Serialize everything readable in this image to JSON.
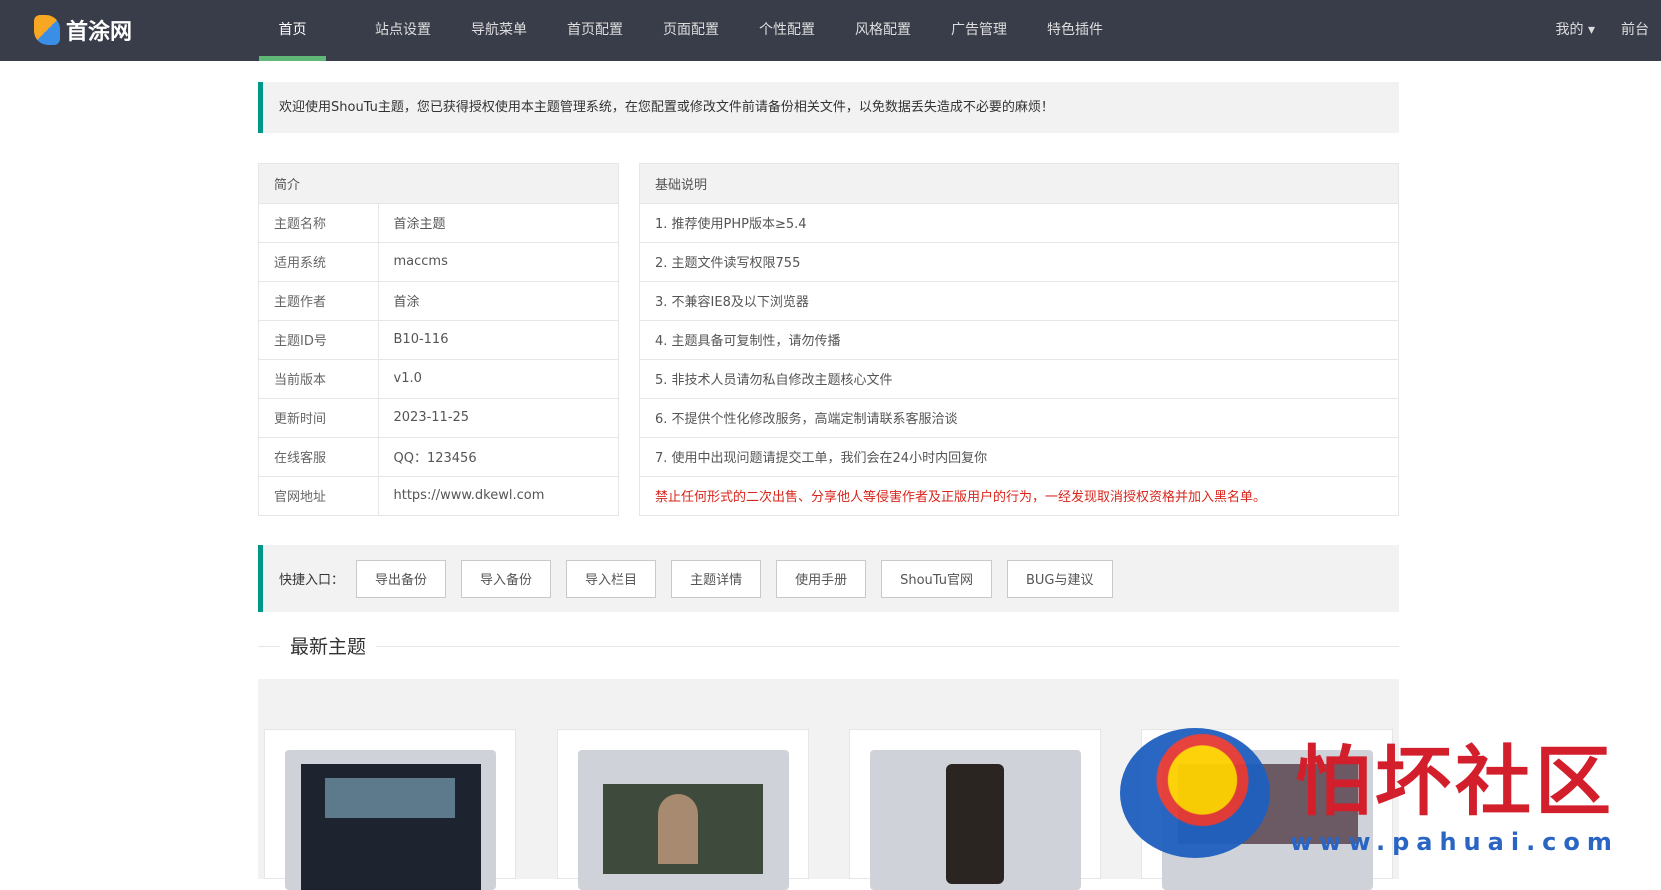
{
  "brand": {
    "name": "首涂网"
  },
  "nav": {
    "items": [
      "首页",
      "站点设置",
      "导航菜单",
      "首页配置",
      "页面配置",
      "个性配置",
      "风格配置",
      "广告管理",
      "特色插件"
    ],
    "active": "首页",
    "user": "我的 ▾",
    "front": "前台"
  },
  "notice": "欢迎使用ShouTu主题，您已获得授权使用本主题管理系统，在您配置或修改文件前请备份相关文件，以免数据丢失造成不必要的麻烦！",
  "intro": {
    "title": "简介",
    "rows": [
      {
        "k": "主题名称",
        "v": "首涂主题"
      },
      {
        "k": "适用系统",
        "v": "maccms"
      },
      {
        "k": "主题作者",
        "v": "首涂"
      },
      {
        "k": "主题ID号",
        "v": "B10-116"
      },
      {
        "k": "当前版本",
        "v": "v1.0"
      },
      {
        "k": "更新时间",
        "v": "2023-11-25"
      },
      {
        "k": "在线客服",
        "v": "QQ：123456"
      },
      {
        "k": "官网地址",
        "v": "https://www.dkewl.com"
      }
    ]
  },
  "basics": {
    "title": "基础说明",
    "rows": [
      "1. 推荐使用PHP版本≥5.4",
      "2. 主题文件读写权限755",
      "3. 不兼容IE8及以下浏览器",
      "4. 主题具备可复制性，请勿传播",
      "5. 非技术人员请勿私自修改主题核心文件",
      "6. 不提供个性化修改服务，高端定制请联系客服洽谈",
      "7. 使用中出现问题请提交工单，我们会在24小时内回复你"
    ],
    "warning": "禁止任何形式的二次出售、分享他人等侵害作者及正版用户的行为，一经发现取消授权资格并加入黑名单。"
  },
  "quick": {
    "label": "快捷入口：",
    "buttons": [
      "导出备份",
      "导入备份",
      "导入栏目",
      "主题详情",
      "使用手册",
      "ShouTu官网",
      "BUG与建议"
    ]
  },
  "latest": {
    "title": "最新主题"
  },
  "watermark": {
    "text": "怕坏社区",
    "url": "www.pahuai.com"
  }
}
